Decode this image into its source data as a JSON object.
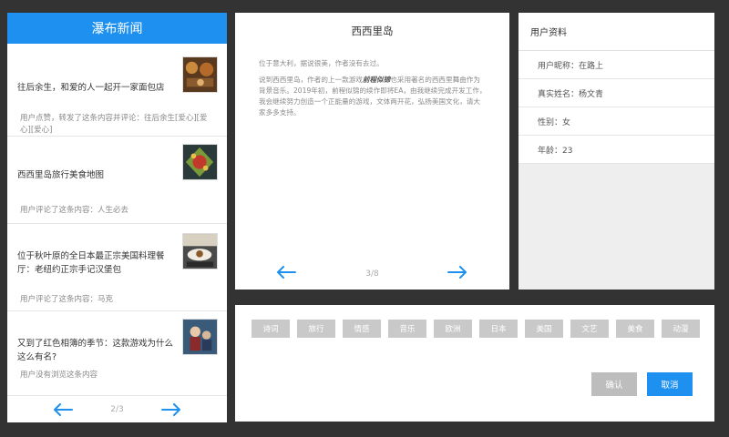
{
  "feed": {
    "header": "瀑布新闻",
    "items": [
      {
        "title": "往后余生，和爱的人一起开一家面包店",
        "meta": "用户点赞，转发了这条内容并评论：往后余生[爱心][爱心][爱心]"
      },
      {
        "title": "西西里岛旅行美食地图",
        "meta": "用户评论了这条内容：人生必去"
      },
      {
        "title": "位于秋叶原的全日本最正宗美国料理餐厅：老纽约正宗手记汉堡包",
        "meta": "用户评论了这条内容：马克"
      },
      {
        "title": "又到了红色相簿的季节：这款游戏为什么这么有名?",
        "meta": "用户没有浏览这条内容"
      }
    ],
    "pager": "2/3"
  },
  "article": {
    "title": "西西里岛",
    "p1": "位于意大利，据说很美，作者没有去过。",
    "p2_pre": "说到西西里岛，作者的上一款游戏",
    "p2_bold": "前程似锦",
    "p2_post": "也采用著名的西西里舞曲作为背景音乐。2019年初，前程似锦的续作即将EA，由我继续完成开发工作，我会继续努力创造一个正能量的游戏，文体两开花，弘扬美国文化，请大家多多支持。",
    "pager": "3/8"
  },
  "profile": {
    "header": "用户资料",
    "rows": [
      "用户昵称：在路上",
      "真实姓名：杨文青",
      "性别：女",
      "年龄：23"
    ]
  },
  "tags": {
    "items": [
      "诗词",
      "旅行",
      "情感",
      "音乐",
      "欧洲",
      "日本",
      "美国",
      "文艺",
      "美食",
      "动漫"
    ],
    "confirm": "确认",
    "cancel": "取消"
  },
  "colors": {
    "accent": "#1e90f0",
    "background": "#333333",
    "tag": "#c9c9c9"
  }
}
